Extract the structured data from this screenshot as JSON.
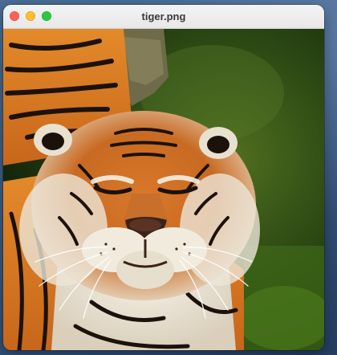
{
  "window": {
    "title": "tiger.png"
  },
  "image": {
    "description_icon": "tiger-photo",
    "colors": {
      "background_green": "#2d4a14",
      "fur_orange": "#d97a22",
      "stripe_dark": "#1c120b",
      "fur_white": "#ece6d8"
    }
  }
}
